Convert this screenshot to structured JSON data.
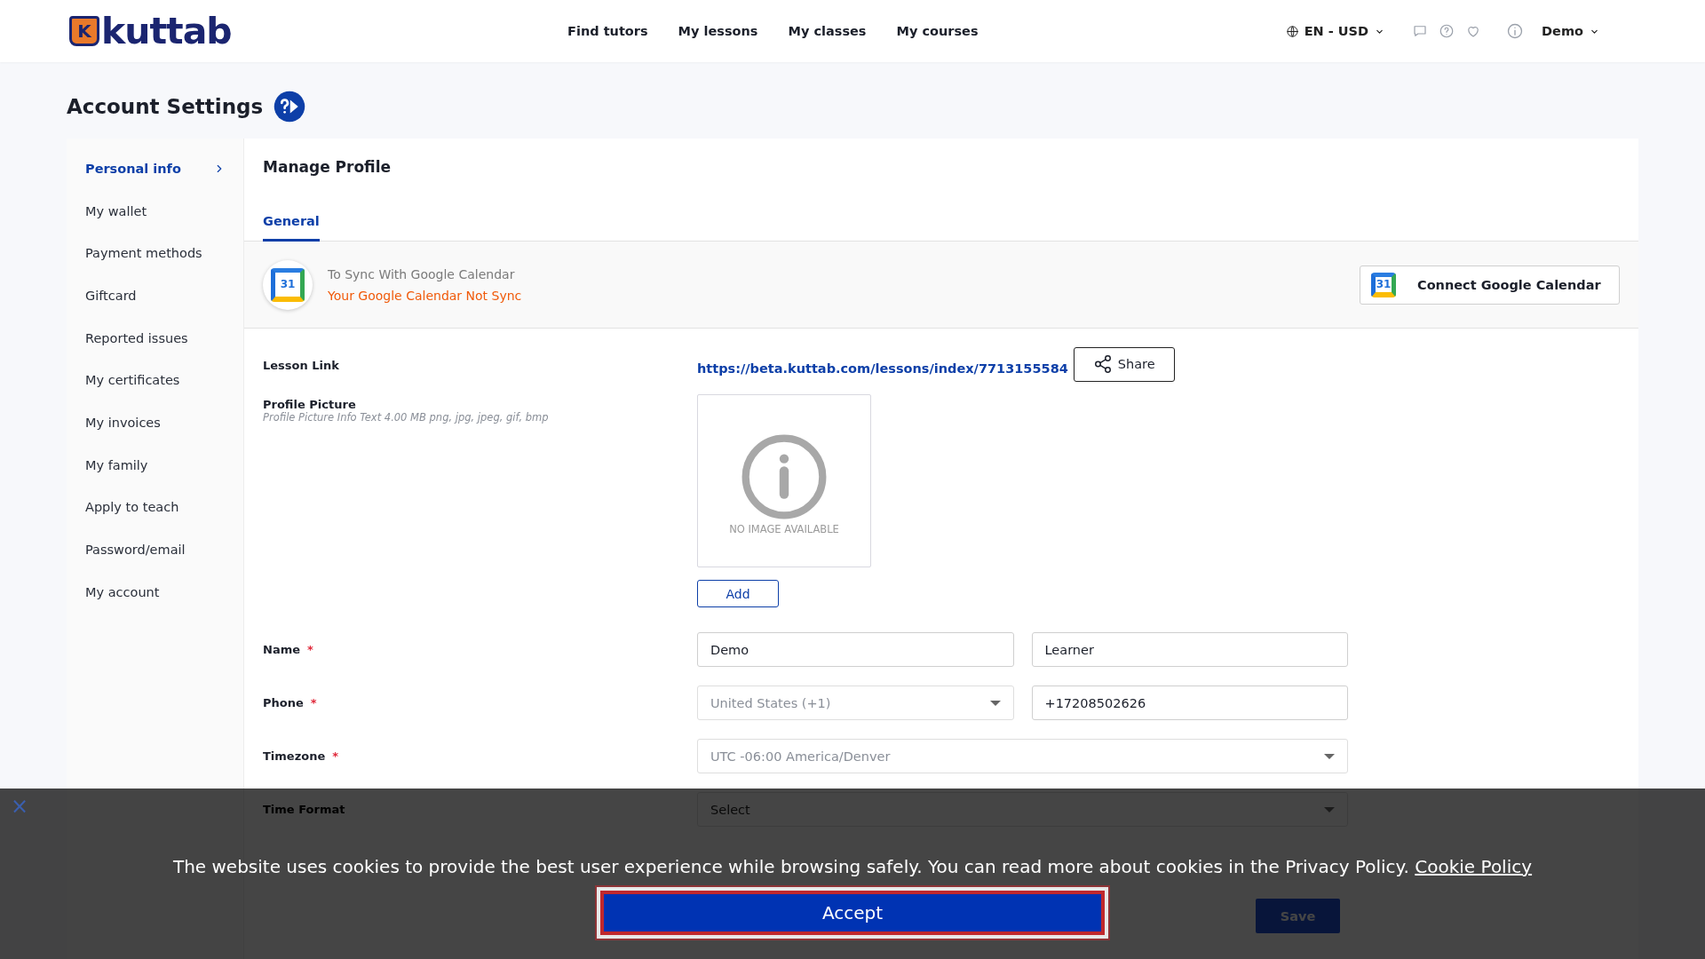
{
  "header": {
    "logo": {
      "mark": "K",
      "text": "kuttab"
    },
    "nav": [
      {
        "label": "Find tutors"
      },
      {
        "label": "My lessons"
      },
      {
        "label": "My classes"
      },
      {
        "label": "My courses"
      }
    ],
    "language": "EN - USD",
    "user": "Demo"
  },
  "page_title": "Account Settings",
  "sidebar": {
    "items": [
      {
        "label": "Personal info",
        "selected": true
      },
      {
        "label": "My wallet",
        "selected": false
      },
      {
        "label": "Payment methods",
        "selected": false
      },
      {
        "label": "Giftcard",
        "selected": false
      },
      {
        "label": "Reported issues",
        "selected": false
      },
      {
        "label": "My certificates",
        "selected": false
      },
      {
        "label": "My invoices",
        "selected": false
      },
      {
        "label": "My family",
        "selected": false
      },
      {
        "label": "Apply to teach",
        "selected": false
      },
      {
        "label": "Password/email",
        "selected": false
      },
      {
        "label": "My account",
        "selected": false
      }
    ]
  },
  "panel": {
    "title": "Manage Profile",
    "tabs": [
      {
        "label": "General",
        "selected": true
      }
    ],
    "sync": {
      "icon_text": "31",
      "title": "To Sync With Google Calendar",
      "status": "Your Google Calendar Not Sync",
      "connect_button": {
        "icon_text": "31",
        "label": "Connect Google Calendar"
      }
    },
    "lesson_link": {
      "label": "Lesson Link",
      "url": "https://beta.kuttab.com/lessons/index/7713155584",
      "share_button": "Share"
    },
    "profile_picture": {
      "label": "Profile Picture",
      "hint": "Profile Picture Info Text 4.00 MB png, jpg, jpeg, gif, bmp",
      "placeholder_text": "NO IMAGE AVAILABLE",
      "add_button": "Add"
    },
    "rows": [
      {
        "label": "Name",
        "required_mark": "*",
        "inputs": [
          {
            "kind": "text",
            "value": "Demo"
          },
          {
            "kind": "text",
            "value": "Learner"
          }
        ]
      },
      {
        "label": "Phone",
        "required_mark": "*",
        "inputs": [
          {
            "kind": "select",
            "value": "United States (+1)"
          },
          {
            "kind": "text",
            "value": "+17208502626"
          }
        ]
      },
      {
        "label": "Timezone",
        "required_mark": "*",
        "inputs": [
          {
            "kind": "select",
            "value": "UTC -06:00 America/Denver"
          }
        ]
      },
      {
        "label": "Time Format",
        "inputs": [
          {
            "kind": "select",
            "placeholder": "Select"
          }
        ]
      }
    ],
    "save_button": "Save"
  },
  "cookie_banner": {
    "close": "×",
    "text": "The website uses cookies to provide the best user experience while browsing safely. You can read more about cookies in the Privacy Policy.",
    "link": "Cookie Policy",
    "accept_button": "Accept"
  }
}
